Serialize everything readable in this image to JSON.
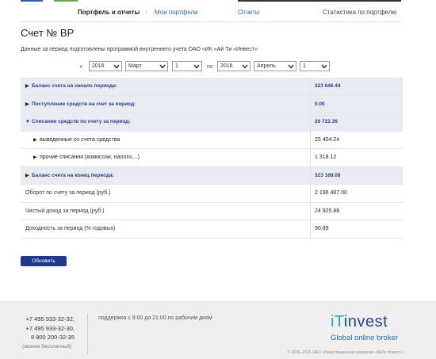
{
  "nav": {
    "active": "Портфель и отчеты",
    "link_my_portfolios": "Мои портфели",
    "link_reports": "Отчеты",
    "link_stats": "Статистика по портфелю"
  },
  "page": {
    "title": "Счет № BP",
    "intro": "Данные за период подготовлены программой внутреннего учета ОАО «ИК «Ай Ти «Инвест»"
  },
  "filters": {
    "from_label": "с",
    "to_label": "по",
    "from_year": "2016",
    "from_month": "Март",
    "from_day": "1",
    "to_year": "2016",
    "to_month": "Апрель",
    "to_day": "1"
  },
  "table": {
    "rows": [
      {
        "label": "Баланс счета на начало периода:",
        "value": "323 646.44"
      },
      {
        "label": "Поступление средств на счет за период:",
        "value": "0.00"
      },
      {
        "label": "Списание средств по счету за период:",
        "value": "26 722.36"
      },
      {
        "label": "выведенные со счета средства",
        "value": "25 404.24"
      },
      {
        "label": "прочие списания (комиссии, налоги,...)",
        "value": "1 318.12"
      },
      {
        "label": "Баланс счета на конец периода:",
        "value": "323 168.08"
      },
      {
        "label": "Оборот по счету за период (руб.)",
        "value": "2 196 487.00"
      },
      {
        "label": "Чистый доход за период (руб.)",
        "value": "24 925.88"
      },
      {
        "label": "Доходность за период (% годовых)",
        "value": "90.89"
      }
    ]
  },
  "button": {
    "refresh": "Обновить"
  },
  "footer": {
    "phone1": "+7 495 933-32-32,",
    "phone2": "+7 495 933-32-30,",
    "phone3": "8 800 200-32-35",
    "free_call": "(звонок бесплатный)",
    "support": "поддержка с 9:00 до 21:00 по рабочим дням",
    "logo_it": "iT",
    "logo_rest": "invest",
    "logo_tagline": "Global online broker",
    "copyright": "© 2000–2016 ОАО «Инвестиционная компания «АйТи Инвест»"
  }
}
